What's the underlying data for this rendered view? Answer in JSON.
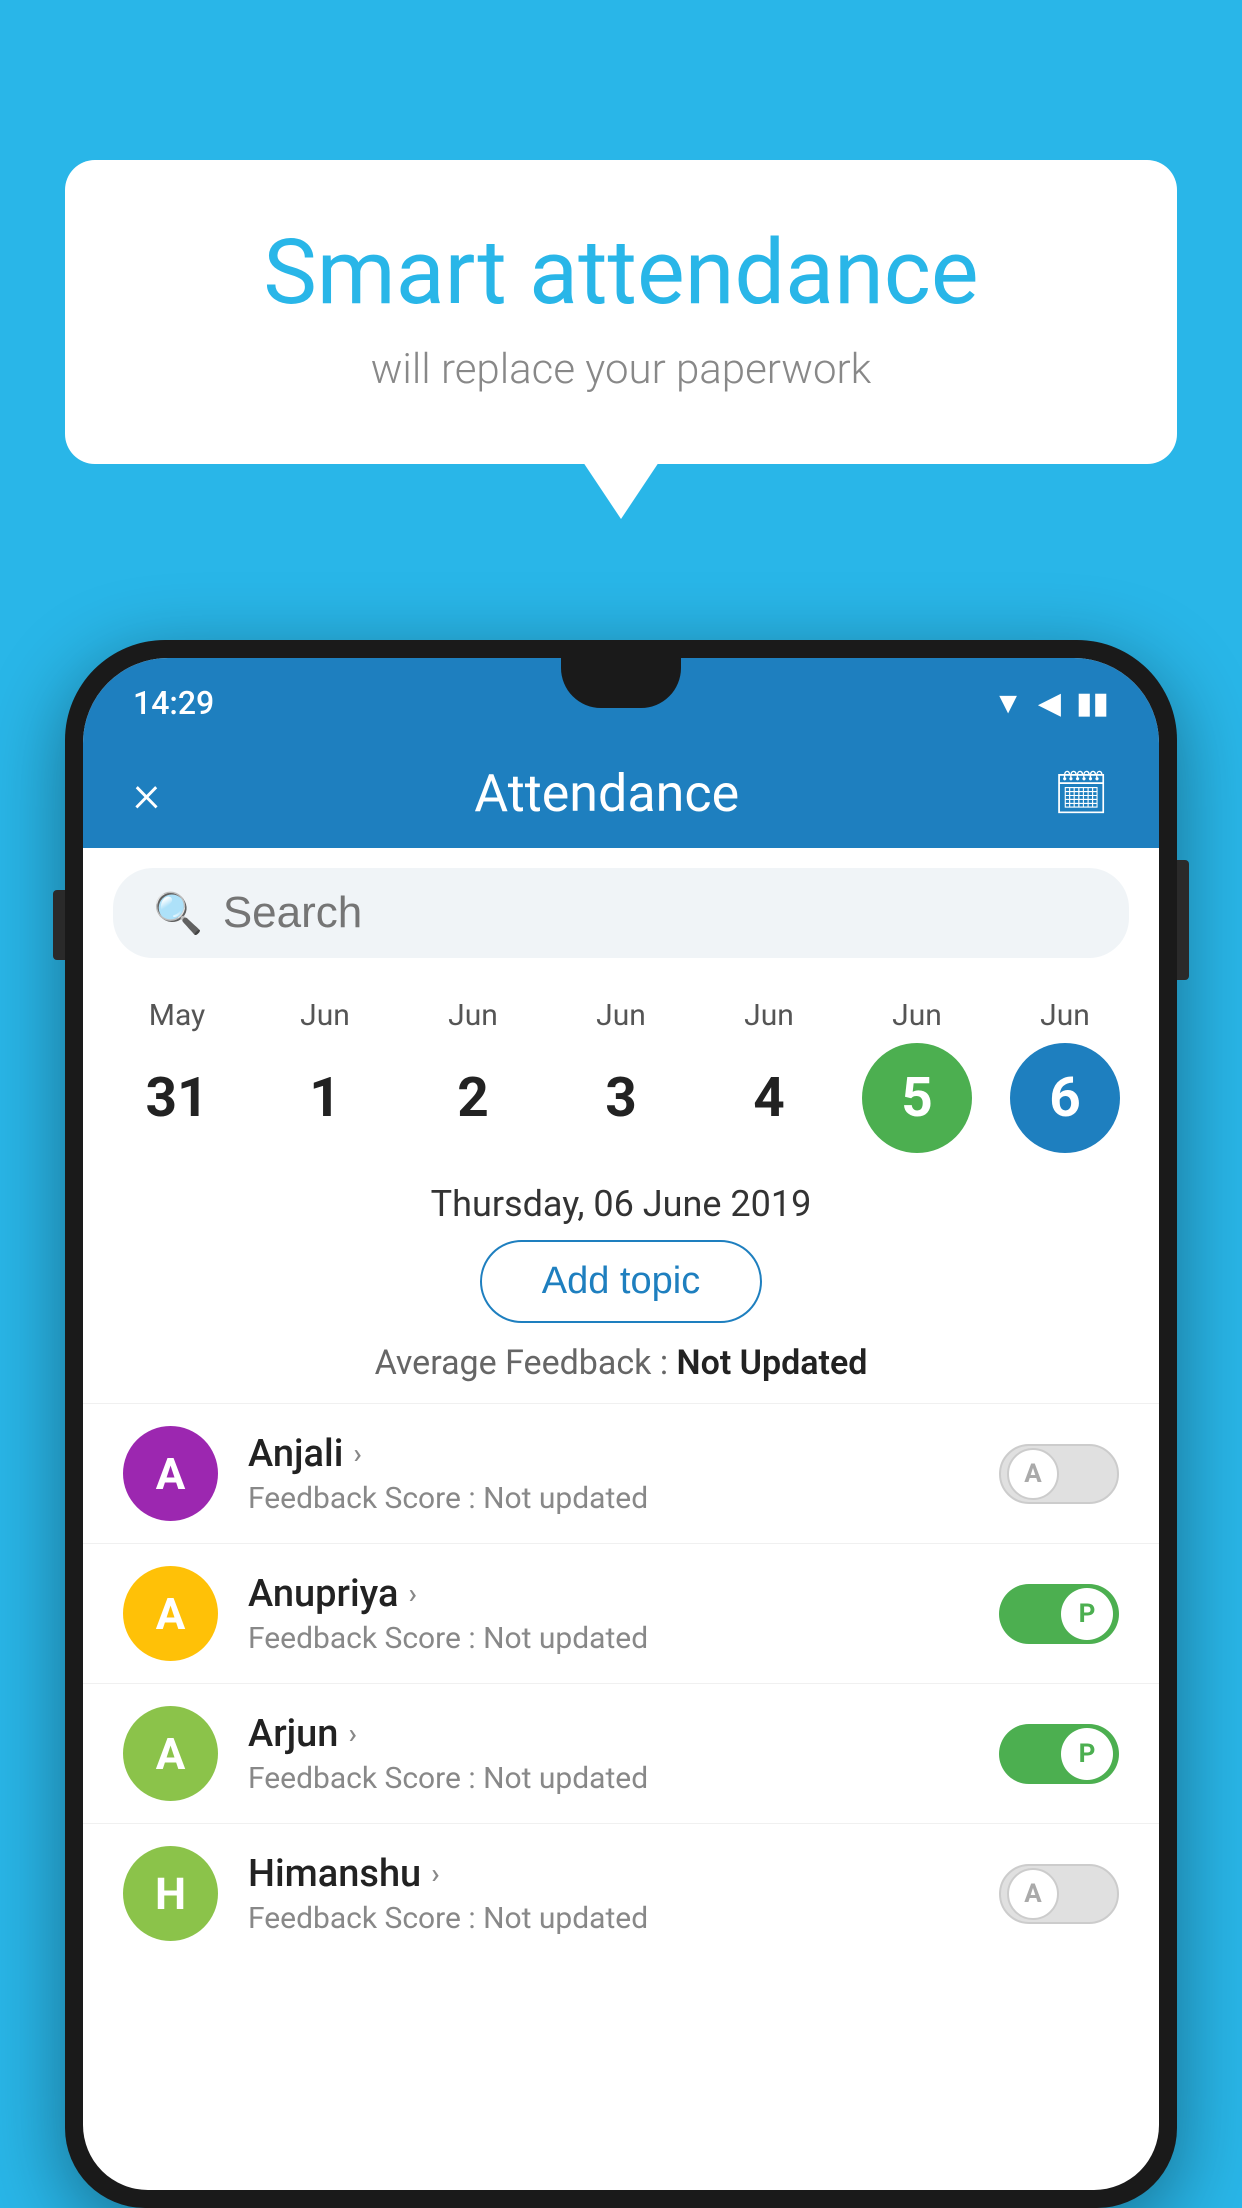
{
  "background_color": "#29b6e8",
  "speech_bubble": {
    "title": "Smart attendance",
    "subtitle": "will replace your paperwork"
  },
  "status_bar": {
    "time": "14:29",
    "wifi": "▲",
    "signal": "◀",
    "battery": "▬"
  },
  "header": {
    "title": "Attendance",
    "close_label": "×",
    "calendar_icon": "📅"
  },
  "search": {
    "placeholder": "Search"
  },
  "calendar": {
    "days": [
      {
        "month": "May",
        "date": "31",
        "style": "normal"
      },
      {
        "month": "Jun",
        "date": "1",
        "style": "normal"
      },
      {
        "month": "Jun",
        "date": "2",
        "style": "normal"
      },
      {
        "month": "Jun",
        "date": "3",
        "style": "normal"
      },
      {
        "month": "Jun",
        "date": "4",
        "style": "normal"
      },
      {
        "month": "Jun",
        "date": "5",
        "style": "today"
      },
      {
        "month": "Jun",
        "date": "6",
        "style": "selected"
      }
    ]
  },
  "selected_date_label": "Thursday, 06 June 2019",
  "add_topic_label": "Add topic",
  "avg_feedback_label": "Average Feedback :",
  "avg_feedback_value": "Not Updated",
  "students": [
    {
      "name": "Anjali",
      "avatar_letter": "A",
      "avatar_color": "#9c27b0",
      "feedback": "Feedback Score : Not updated",
      "attendance": "absent",
      "toggle_label": "A"
    },
    {
      "name": "Anupriya",
      "avatar_letter": "A",
      "avatar_color": "#ffc107",
      "feedback": "Feedback Score : Not updated",
      "attendance": "present",
      "toggle_label": "P"
    },
    {
      "name": "Arjun",
      "avatar_letter": "A",
      "avatar_color": "#8bc34a",
      "feedback": "Feedback Score : Not updated",
      "attendance": "present",
      "toggle_label": "P"
    },
    {
      "name": "Himanshu",
      "avatar_letter": "H",
      "avatar_color": "#8bc34a",
      "feedback": "Feedback Score : Not updated",
      "attendance": "absent",
      "toggle_label": "A"
    }
  ]
}
